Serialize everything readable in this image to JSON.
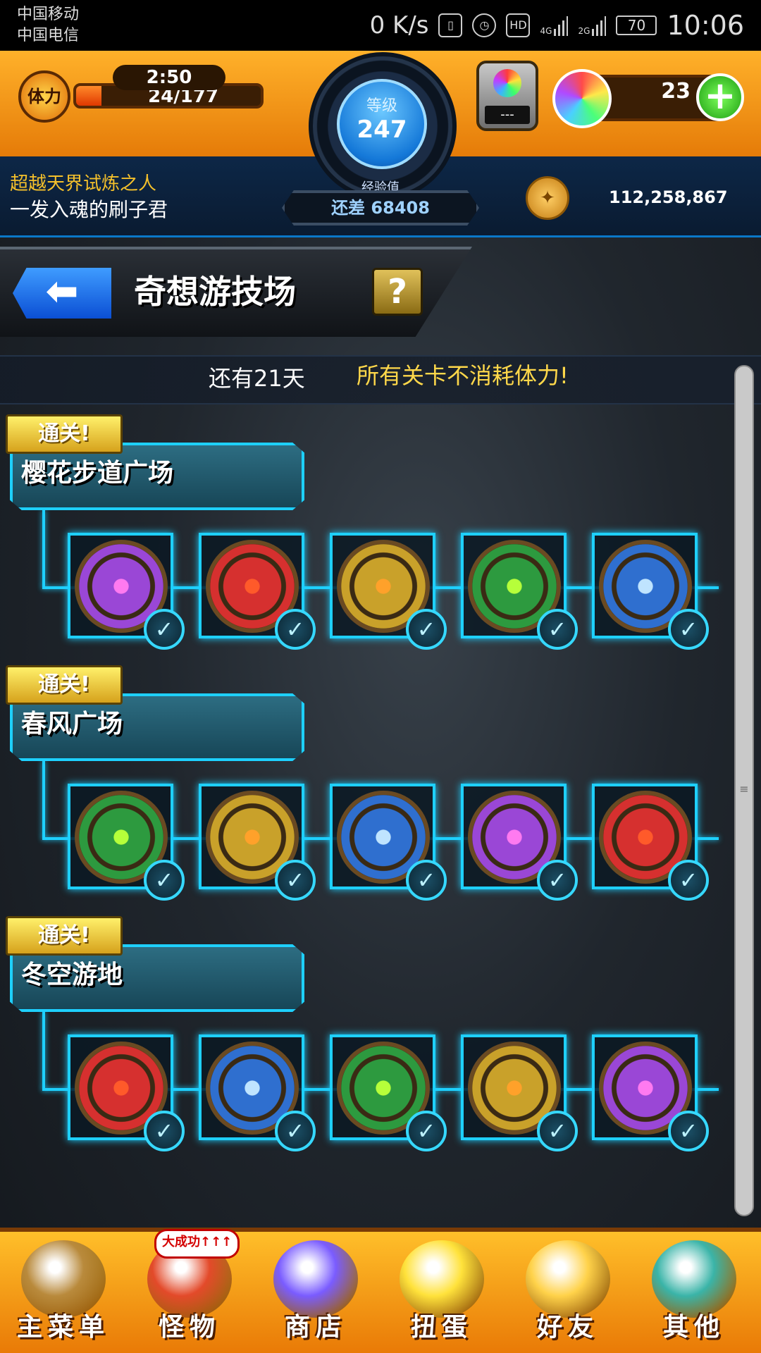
{
  "status_bar": {
    "carrier_1": "中国移动",
    "carrier_2": "中国电信",
    "net_speed": "0 K/s",
    "hd_badge": "HD",
    "network_1": "4G",
    "network_2": "2G",
    "battery": "70",
    "time": "10:06"
  },
  "hud": {
    "stamina_label": "体力",
    "stamina_timer": "2:50",
    "stamina_value": "24/177",
    "stamina_fraction": 0.136,
    "level_label": "等级",
    "level": "247",
    "exp_label": "经验值",
    "exp_remaining": "还差 68408",
    "gacha_value": "---",
    "orbs": "23",
    "orb_plus": "+",
    "player_title": "超越天界试炼之人",
    "player_name": "一发入魂的刷子君",
    "coins": "112,258,867"
  },
  "event": {
    "back_icon": "back-arrow-icon",
    "title": "奇想游技场",
    "help_label": "?",
    "days_left": "还有21天",
    "notice": "所有关卡不消耗体力!"
  },
  "sections": [
    {
      "clear_label": "通关!",
      "name": "樱花步道广场",
      "stages": [
        {
          "color": "#9a47d6",
          "glow": "#ff7af0",
          "cleared": true
        },
        {
          "color": "#d6302f",
          "glow": "#ff5a2a",
          "cleared": true
        },
        {
          "color": "#c9a12a",
          "glow": "#ffa12a",
          "cleared": true
        },
        {
          "color": "#2d9a3f",
          "glow": "#b6ff3a",
          "cleared": true
        },
        {
          "color": "#2f6fcf",
          "glow": "#bfe4ff",
          "cleared": true
        }
      ]
    },
    {
      "clear_label": "通关!",
      "name": "春风广场",
      "stages": [
        {
          "color": "#2d9a3f",
          "glow": "#b6ff3a",
          "cleared": true
        },
        {
          "color": "#c9a12a",
          "glow": "#ffa12a",
          "cleared": true
        },
        {
          "color": "#2f6fcf",
          "glow": "#bfe4ff",
          "cleared": true
        },
        {
          "color": "#9a47d6",
          "glow": "#ff7af0",
          "cleared": true
        },
        {
          "color": "#d6302f",
          "glow": "#ff5a2a",
          "cleared": true
        }
      ]
    },
    {
      "clear_label": "通关!",
      "name": "冬空游地",
      "stages": [
        {
          "color": "#d6302f",
          "glow": "#ff5a2a",
          "cleared": true
        },
        {
          "color": "#2f6fcf",
          "glow": "#bfe4ff",
          "cleared": true
        },
        {
          "color": "#2d9a3f",
          "glow": "#b6ff3a",
          "cleared": true
        },
        {
          "color": "#c9a12a",
          "glow": "#ffa12a",
          "cleared": true
        },
        {
          "color": "#9a47d6",
          "glow": "#ff7af0",
          "cleared": true
        }
      ]
    }
  ],
  "check_glyph": "✓",
  "bottom_nav": [
    {
      "label": "主菜单",
      "icon": "main-menu-gate-icon",
      "color": "#b98a3c"
    },
    {
      "label": "怪物",
      "icon": "monster-icon",
      "color": "#e34a2a",
      "badge": "大成功↑↑↑"
    },
    {
      "label": "商店",
      "icon": "rainbow-orb-icon",
      "color": "#7a5cff"
    },
    {
      "label": "扭蛋",
      "icon": "gacha-egg-icon",
      "color": "#ffe23b"
    },
    {
      "label": "好友",
      "icon": "friends-balloon-icon",
      "color": "#ffd24a"
    },
    {
      "label": "其他",
      "icon": "other-menu-icon",
      "color": "#3ab4a8"
    }
  ],
  "colors": {
    "accent_orange": "#ffb12a",
    "frame_cyan": "#1ed0ff",
    "notice_yellow": "#ffd84a"
  }
}
